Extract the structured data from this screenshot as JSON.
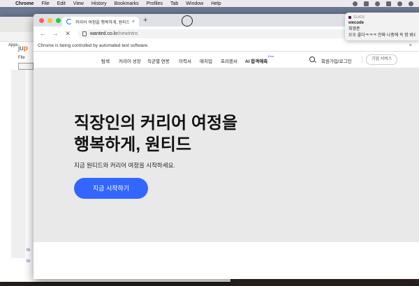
{
  "menubar": {
    "app": "Chrome",
    "items": [
      "File",
      "Edit",
      "View",
      "History",
      "Bookmarks",
      "Profiles",
      "Tab",
      "Window",
      "Help"
    ]
  },
  "back_window": {
    "apps_label": "Apps",
    "jupyter_prefix": "ju",
    "jupyter_suffix": "p",
    "file_menu": "File",
    "in_labels": [
      "In",
      "In"
    ]
  },
  "browser": {
    "tab_title": "커리어 여정을 행복하게, 원티드",
    "new_tab": "+",
    "url_host": "wanted.co.kr",
    "url_path": "/newintro",
    "infobar_text": "Chrome is being controlled by automated test software.",
    "infobar_close": "×"
  },
  "site": {
    "nav": [
      "탐색",
      "커리어 성장",
      "직군별 연봉",
      "이력서",
      "매치업",
      "프리랜서",
      "AI 합격예측"
    ],
    "beta": "Beta",
    "login": "회원가입/로그인",
    "corp": "기업 서비스",
    "hero_title_line1": "직장인의 커리어 여정을",
    "hero_title_line2": "행복하게, 원티드",
    "hero_sub": "지금 원티드와 커리어 여정을 시작하세요.",
    "cta": "지금 시작하기"
  },
  "notification": {
    "app": "SLACK",
    "title": "wecode",
    "sender": "최영준",
    "message": "오오 올다ㅋㅋㅋ 진짜 나중에 꼭 함 봐요!"
  },
  "colors": {
    "accent": "#3366ff",
    "hero_bg": "#e9e9ea"
  }
}
